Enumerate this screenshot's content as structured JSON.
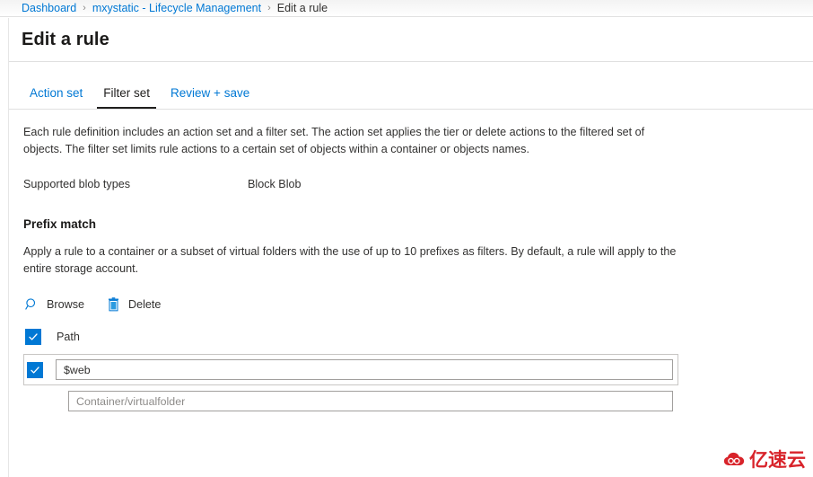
{
  "breadcrumb": {
    "items": [
      {
        "label": "Dashboard",
        "current": false
      },
      {
        "label": "mxystatic - Lifecycle Management",
        "current": false
      },
      {
        "label": "Edit a rule",
        "current": true
      }
    ],
    "separator": "›"
  },
  "page": {
    "title": "Edit a rule"
  },
  "tabs": [
    {
      "label": "Action set",
      "active": false
    },
    {
      "label": "Filter set",
      "active": true
    },
    {
      "label": "Review + save",
      "active": false
    }
  ],
  "main": {
    "intro": "Each rule definition includes an action set and a filter set. The action set applies the tier or delete actions to the filtered set of objects. The filter set limits rule actions to a certain set of objects within a container or objects names.",
    "blob_types": {
      "label": "Supported blob types",
      "value": "Block Blob"
    },
    "prefix_match": {
      "heading": "Prefix match",
      "description": "Apply a rule to a container or a subset of virtual folders with the use of up to 10 prefixes as filters. By default, a rule will apply to the entire storage account.",
      "commands": [
        {
          "label": "Browse",
          "icon": "search-icon"
        },
        {
          "label": "Delete",
          "icon": "trash-icon"
        }
      ],
      "path_header": {
        "label": "Path",
        "checked": true
      },
      "rows": [
        {
          "checked": true,
          "has_checkbox": true,
          "value": "$web",
          "placeholder": "Container/virtualfolder",
          "selected": true
        },
        {
          "checked": false,
          "has_checkbox": false,
          "value": "",
          "placeholder": "Container/virtualfolder",
          "selected": false
        }
      ]
    }
  },
  "watermark": {
    "text": "亿速云",
    "color": "#d8232a",
    "icon": "cloud-logo-icon"
  },
  "colors": {
    "accent": "#0078d4",
    "text": "#323130",
    "active_tab": "#201f1e",
    "border": "#e0e0e0",
    "watermark": "#d8232a"
  }
}
